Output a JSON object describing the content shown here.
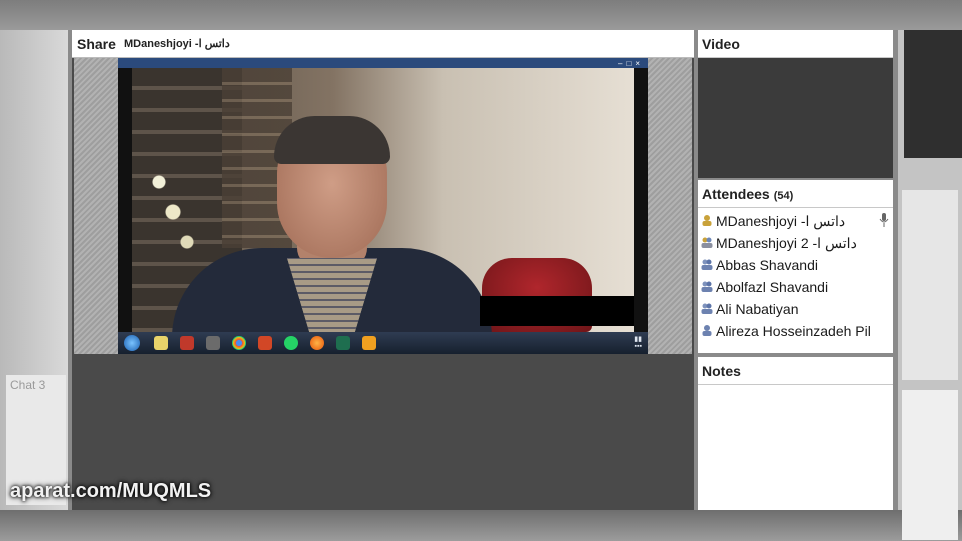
{
  "share": {
    "title": "Share",
    "presenter": "داتس ا- MDaneshjoyi"
  },
  "video": {
    "title": "Video"
  },
  "attendees": {
    "title": "Attendees",
    "count": "(54)",
    "list": [
      {
        "name": "داتس ا- MDaneshjoyi",
        "role": "host"
      },
      {
        "name": "داتس ا- MDaneshjoyi 2",
        "role": "presenter"
      },
      {
        "name": "Abbas Shavandi",
        "role": "participant"
      },
      {
        "name": "Abolfazl Shavandi",
        "role": "participant"
      },
      {
        "name": "Ali Nabatiyan",
        "role": "participant"
      },
      {
        "name": "Alireza Hosseinzadeh Pil",
        "role": "participant"
      }
    ]
  },
  "notes": {
    "title": "Notes"
  },
  "background": {
    "chat_label": "Chat 3"
  },
  "watermark": "aparat.com/MUQMLS",
  "colors": {
    "share_bg": "#4a4a4a",
    "pod_header": "#ffffff",
    "video_bg": "#3b3b3b"
  }
}
